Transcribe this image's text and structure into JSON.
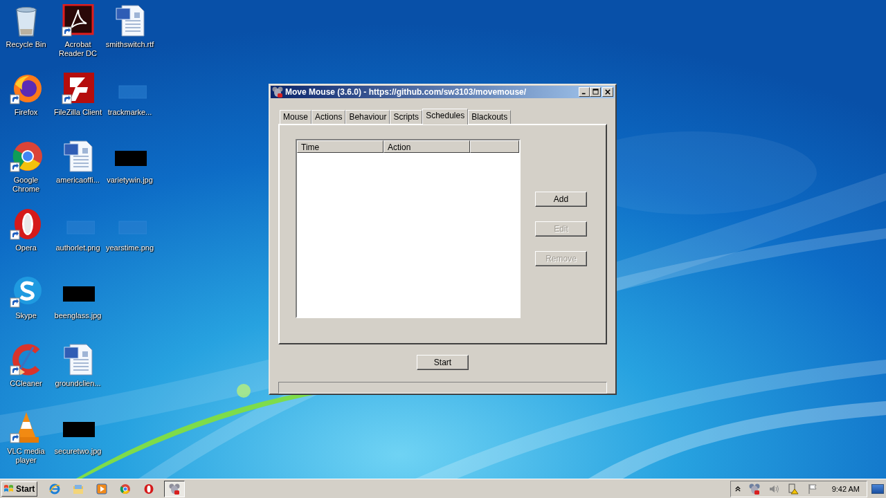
{
  "desktop": {
    "icons": [
      {
        "label": "Recycle Bin",
        "kind": "recycle",
        "shortcut": false
      },
      {
        "label": "Firefox",
        "kind": "firefox",
        "shortcut": true
      },
      {
        "label": "Google Chrome",
        "kind": "chrome",
        "shortcut": true
      },
      {
        "label": "Opera",
        "kind": "opera",
        "shortcut": true
      },
      {
        "label": "Skype",
        "kind": "skype",
        "shortcut": true
      },
      {
        "label": "CCleaner",
        "kind": "ccleaner",
        "shortcut": true
      },
      {
        "label": "VLC media player",
        "kind": "vlc",
        "shortcut": true
      },
      {
        "label": "Acrobat Reader DC",
        "kind": "acrobat",
        "shortcut": true
      },
      {
        "label": "FileZilla Client",
        "kind": "filezilla",
        "shortcut": true
      },
      {
        "label": "americaoffi...",
        "kind": "word",
        "shortcut": false
      },
      {
        "label": "authorlet.png",
        "kind": "blank",
        "shortcut": false
      },
      {
        "label": "beenglass.jpg",
        "kind": "black",
        "shortcut": false
      },
      {
        "label": "groundclien...",
        "kind": "word",
        "shortcut": false
      },
      {
        "label": "securetwo.jpg",
        "kind": "black",
        "shortcut": false
      },
      {
        "label": "smithswitch.rtf",
        "kind": "word",
        "shortcut": false
      },
      {
        "label": "trackmarke...",
        "kind": "blank",
        "shortcut": false
      },
      {
        "label": "varietywin.jpg",
        "kind": "black",
        "shortcut": false
      },
      {
        "label": "yearstime.png",
        "kind": "blank",
        "shortcut": false
      }
    ]
  },
  "window": {
    "title": "Move Mouse (3.6.0) - https://github.com/sw3103/movemouse/",
    "tabs": [
      {
        "label": "Mouse",
        "selected": false
      },
      {
        "label": "Actions",
        "selected": false
      },
      {
        "label": "Behaviour",
        "selected": false
      },
      {
        "label": "Scripts",
        "selected": false
      },
      {
        "label": "Schedules",
        "selected": true
      },
      {
        "label": "Blackouts",
        "selected": false
      }
    ],
    "table": {
      "columns": [
        "Time",
        "Action"
      ]
    },
    "buttons": [
      {
        "label": "Add",
        "disabled": false
      },
      {
        "label": "Edit",
        "disabled": true
      },
      {
        "label": "Remove",
        "disabled": true
      }
    ],
    "start_button": "Start"
  },
  "taskbar": {
    "start": "Start",
    "apps": [
      {
        "kind": "ie",
        "active": false
      },
      {
        "kind": "explorer",
        "active": false
      },
      {
        "kind": "media",
        "active": false
      },
      {
        "kind": "chrome",
        "active": false
      },
      {
        "kind": "opera",
        "active": false
      },
      {
        "kind": "mouse",
        "active": true
      }
    ],
    "clock": "9:42 AM"
  }
}
